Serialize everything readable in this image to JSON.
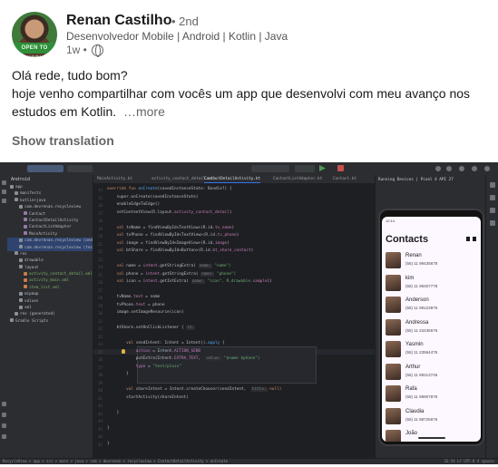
{
  "post": {
    "author": "Renan Castilho",
    "degree": "• 2nd",
    "headline": "Desenvolvedor Mobile | Android | Kotlin | Java",
    "time": "1w •",
    "avatar_badge": "OPEN TO WORK",
    "text_line1": "Olá rede, tudo bom?",
    "text_line2": "hoje venho compartilhar com vocês um app que desenvolvi com meu avanço nos estudos em Kotlin.",
    "more": "…more",
    "show_translation": "Show translation"
  },
  "ide": {
    "colors": {
      "background": "#1e1f22",
      "panel": "#2b2d30",
      "accent": "#3574f0"
    },
    "title_project": "Recycle View",
    "title_branch": "master",
    "device": "Pixel 4 API 27",
    "run_config": "app",
    "project_header": "Android",
    "tree": [
      {
        "label": "app",
        "kind": "folder",
        "indent": 0
      },
      {
        "label": "manifests",
        "kind": "folder",
        "indent": 1
      },
      {
        "label": "kotlin+java",
        "kind": "folder",
        "indent": 1
      },
      {
        "label": "com.devrenan.recycleview",
        "kind": "folder",
        "indent": 2
      },
      {
        "label": "Contact",
        "kind": "kt",
        "indent": 3
      },
      {
        "label": "ContactDetailActivity",
        "kind": "kt",
        "indent": 3
      },
      {
        "label": "ContactListAdapter",
        "kind": "kt",
        "indent": 3
      },
      {
        "label": "MainActivity",
        "kind": "kt",
        "indent": 3
      },
      {
        "label": "com.devrenan.recycleview (androidTest)",
        "kind": "folder",
        "indent": 2,
        "sel": true
      },
      {
        "label": "com.devrenan.recycleview (test)",
        "kind": "folder",
        "indent": 2,
        "sel": true
      },
      {
        "label": "res",
        "kind": "folder",
        "indent": 1
      },
      {
        "label": "drawable",
        "kind": "folder",
        "indent": 2
      },
      {
        "label": "layout",
        "kind": "folder",
        "indent": 2
      },
      {
        "label": "activity_contact_detail.xml",
        "kind": "xml",
        "indent": 3,
        "green": true
      },
      {
        "label": "activity_main.xml",
        "kind": "xml",
        "indent": 3,
        "green": true
      },
      {
        "label": "item_list.xml",
        "kind": "xml",
        "indent": 3,
        "green": true
      },
      {
        "label": "mipmap",
        "kind": "folder",
        "indent": 2
      },
      {
        "label": "values",
        "kind": "folder",
        "indent": 2
      },
      {
        "label": "xml",
        "kind": "folder",
        "indent": 2
      },
      {
        "label": "res (generated)",
        "kind": "folder",
        "indent": 1
      },
      {
        "label": "Gradle Scripts",
        "kind": "folder",
        "indent": 0
      }
    ],
    "tabs": [
      {
        "label": "MainActivity.kt",
        "active": false
      },
      {
        "label": "activity_contact_detail.xml",
        "active": false
      },
      {
        "label": "ContactDetailActivity.kt",
        "active": true
      },
      {
        "label": "ContactListAdapter.kt",
        "active": false
      },
      {
        "label": "Contact.kt",
        "active": false
      }
    ],
    "code": [
      {
        "n": "14",
        "segs": [
          {
            "t": "override fun ",
            "c": "kw"
          },
          {
            "t": "onCreate",
            "c": "fn"
          },
          {
            "t": "(savedInstanceState: Bundle?) {",
            "c": ""
          }
        ]
      },
      {
        "n": "15",
        "segs": [
          {
            "t": "    super.onCreate(savedInstanceState)",
            "c": ""
          }
        ]
      },
      {
        "n": "16",
        "segs": [
          {
            "t": "    enableEdgeToEdge()",
            "c": ""
          }
        ]
      },
      {
        "n": "17",
        "segs": [
          {
            "t": "    setContentView(R.layout.",
            "c": ""
          },
          {
            "t": "activity_contact_detail",
            "c": "pr"
          },
          {
            "t": ")",
            "c": ""
          }
        ]
      },
      {
        "n": "18",
        "segs": []
      },
      {
        "n": "19",
        "segs": [
          {
            "t": "    val ",
            "c": "kw"
          },
          {
            "t": "tvName = findViewById<TextView>(R.id.",
            "c": ""
          },
          {
            "t": "tv_name",
            "c": "pr"
          },
          {
            "t": ")",
            "c": ""
          }
        ]
      },
      {
        "n": "20",
        "segs": [
          {
            "t": "    val ",
            "c": "kw"
          },
          {
            "t": "tvPhone = findViewById<TextView>(R.id.",
            "c": ""
          },
          {
            "t": "tv_phone",
            "c": "pr"
          },
          {
            "t": ")",
            "c": ""
          }
        ]
      },
      {
        "n": "21",
        "segs": [
          {
            "t": "    val ",
            "c": "kw"
          },
          {
            "t": "image = findViewById<ImageView>(R.id.",
            "c": ""
          },
          {
            "t": "image",
            "c": "pr"
          },
          {
            "t": ")",
            "c": ""
          }
        ]
      },
      {
        "n": "22",
        "segs": [
          {
            "t": "    val ",
            "c": "kw"
          },
          {
            "t": "btShare = findViewById<Button>(R.id.",
            "c": ""
          },
          {
            "t": "bt_share_contact",
            "c": "pr"
          },
          {
            "t": ")",
            "c": ""
          }
        ]
      },
      {
        "n": "23",
        "segs": []
      },
      {
        "n": "24",
        "segs": [
          {
            "t": "    val ",
            "c": "kw"
          },
          {
            "t": "name = ",
            "c": ""
          },
          {
            "t": "intent",
            "c": "pr"
          },
          {
            "t": ".getStringExtra( ",
            "c": ""
          },
          {
            "t": "name:",
            "c": "hint"
          },
          {
            "t": " \"name\")",
            "c": "st"
          }
        ]
      },
      {
        "n": "25",
        "segs": [
          {
            "t": "    val ",
            "c": "kw"
          },
          {
            "t": "phone = ",
            "c": ""
          },
          {
            "t": "intent",
            "c": "pr"
          },
          {
            "t": ".getStringExtra( ",
            "c": ""
          },
          {
            "t": "name:",
            "c": "hint"
          },
          {
            "t": " \"phone\")",
            "c": "st"
          }
        ]
      },
      {
        "n": "26",
        "segs": [
          {
            "t": "    val ",
            "c": "kw"
          },
          {
            "t": "icon = ",
            "c": ""
          },
          {
            "t": "intent",
            "c": "pr"
          },
          {
            "t": ".getIntExtra( ",
            "c": ""
          },
          {
            "t": "name:",
            "c": "hint"
          },
          {
            "t": " \"icon\", R.drawable.",
            "c": "st"
          },
          {
            "t": "sample1",
            "c": "pr"
          },
          {
            "t": ")",
            "c": ""
          }
        ]
      },
      {
        "n": "27",
        "segs": []
      },
      {
        "n": "28",
        "segs": [
          {
            "t": "    tvName.",
            "c": ""
          },
          {
            "t": "text",
            "c": "pr"
          },
          {
            "t": " = name",
            "c": ""
          }
        ]
      },
      {
        "n": "29",
        "segs": [
          {
            "t": "    tvPhone.",
            "c": ""
          },
          {
            "t": "text",
            "c": "pr"
          },
          {
            "t": " = phone",
            "c": ""
          }
        ]
      },
      {
        "n": "30",
        "segs": [
          {
            "t": "    image.setImageResource(icon)",
            "c": ""
          }
        ]
      },
      {
        "n": "31",
        "segs": []
      },
      {
        "n": "32",
        "segs": [
          {
            "t": "    btShare.setOnClickListener { ",
            "c": ""
          },
          {
            "t": "it:",
            "c": "hint"
          }
        ]
      },
      {
        "n": "33",
        "segs": []
      },
      {
        "n": "34",
        "segs": [
          {
            "t": "        val ",
            "c": "kw"
          },
          {
            "t": "sendIntent: Intent = Intent().",
            "c": ""
          },
          {
            "t": "apply",
            "c": "fn"
          },
          {
            "t": " {",
            "c": ""
          }
        ]
      },
      {
        "n": "35",
        "segs": [
          {
            "t": "            ",
            "c": ""
          },
          {
            "t": "action",
            "c": "pr"
          },
          {
            "t": " = Intent.",
            "c": ""
          },
          {
            "t": "ACTION_SEND",
            "c": "pr"
          }
        ]
      },
      {
        "n": "36",
        "segs": [
          {
            "t": "            putExtra(Intent.",
            "c": ""
          },
          {
            "t": "EXTRA_TEXT",
            "c": "pr"
          },
          {
            "t": ",  ",
            "c": ""
          },
          {
            "t": "value:",
            "c": "hint"
          },
          {
            "t": " \"$name $phone\")",
            "c": "st"
          }
        ]
      },
      {
        "n": "37",
        "segs": [
          {
            "t": "            ",
            "c": ""
          },
          {
            "t": "type",
            "c": "pr"
          },
          {
            "t": " = ",
            "c": ""
          },
          {
            "t": "\"text/plain\"",
            "c": "st"
          }
        ]
      },
      {
        "n": "38",
        "segs": [
          {
            "t": "        }",
            "c": ""
          }
        ]
      },
      {
        "n": "39",
        "segs": []
      },
      {
        "n": "40",
        "segs": [
          {
            "t": "        val ",
            "c": "kw"
          },
          {
            "t": "shareIntent = Intent.createChooser(sendIntent,  ",
            "c": ""
          },
          {
            "t": "title:",
            "c": "hint"
          },
          {
            "t": " null)",
            "c": "kw"
          }
        ]
      },
      {
        "n": "41",
        "segs": [
          {
            "t": "        startActivity(shareIntent)",
            "c": ""
          }
        ]
      },
      {
        "n": "42",
        "segs": []
      },
      {
        "n": "43",
        "segs": [
          {
            "t": "    }",
            "c": ""
          }
        ]
      },
      {
        "n": "44",
        "segs": []
      },
      {
        "n": "45",
        "segs": [
          {
            "t": "}",
            "c": ""
          }
        ]
      },
      {
        "n": "46",
        "segs": []
      },
      {
        "n": "47",
        "segs": [
          {
            "t": "}",
            "c": ""
          }
        ]
      }
    ],
    "running_tabs": "Running Devices  |  Pixel 4 API 27",
    "statusbar_left": "RecycleView > app > src > main > java > com > devrenan > recycleview > ContactDetailActivity > onCreate",
    "statusbar_right": "32:54   LF   UTF-8   4 spaces"
  },
  "phone": {
    "status_time": "12:14",
    "title": "Contacts",
    "contacts": [
      {
        "name": "Renan",
        "phone": "(55) 11 99435678"
      },
      {
        "name": "kim",
        "phone": "(55) 11 98457778"
      },
      {
        "name": "Anderson",
        "phone": "(55) 11 99123876"
      },
      {
        "name": "Andressa",
        "phone": "(55) 11 23435676"
      },
      {
        "name": "Yasmin",
        "phone": "(55) 11 23564476"
      },
      {
        "name": "Arthur",
        "phone": "(55) 11 89213746"
      },
      {
        "name": "Rafa",
        "phone": "(55) 11 98907876"
      },
      {
        "name": "Claudia",
        "phone": "(55) 11 98725676"
      },
      {
        "name": "João",
        "phone": ""
      }
    ]
  }
}
